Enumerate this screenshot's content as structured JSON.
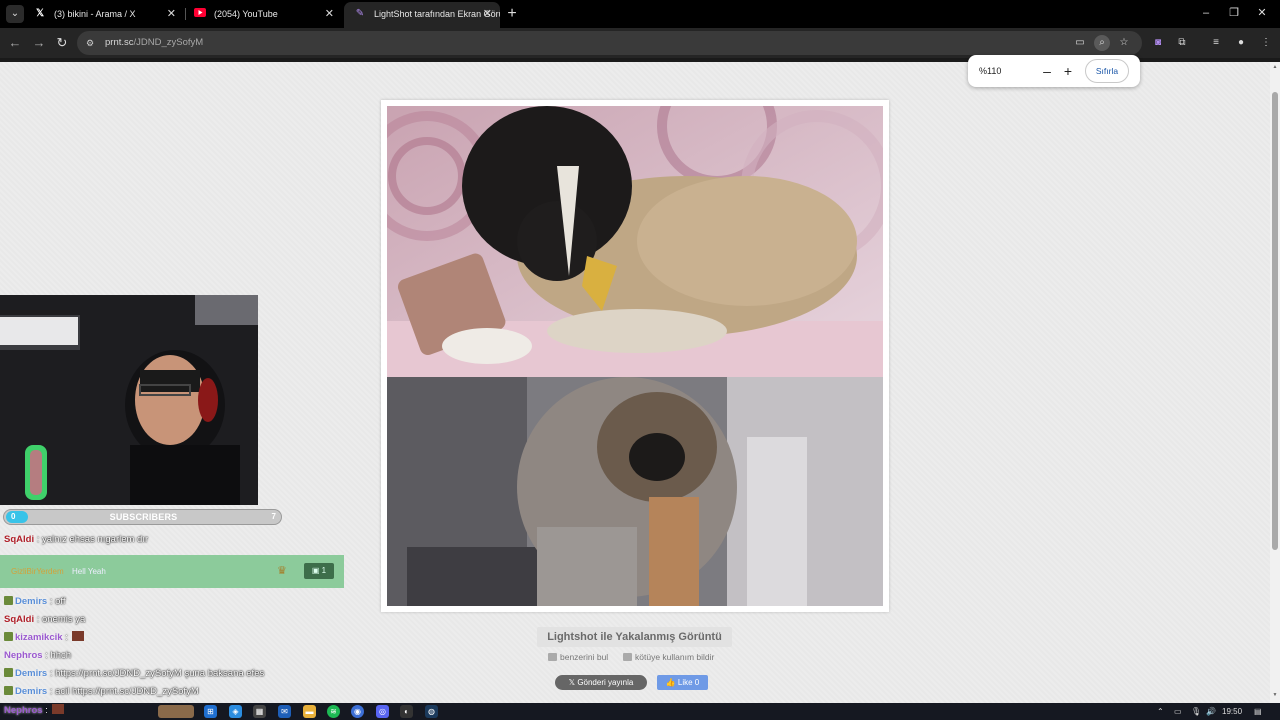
{
  "browser": {
    "tabs": [
      {
        "title": "(3) bikini - Arama / X",
        "icon": "x-logo-icon",
        "active": false
      },
      {
        "title": "(2054) YouTube",
        "icon": "youtube-icon",
        "active": false
      },
      {
        "title": "LightShot tarafından Ekran Görü",
        "icon": "lightshot-feather-icon",
        "active": true
      }
    ],
    "new_tab_label": "+",
    "window_controls": {
      "minimize": "–",
      "restore": "❐",
      "close": "✕"
    },
    "url_host": "prnt.sc",
    "url_path": "/JDND_zySofyM"
  },
  "zoom_popup": {
    "value": "%110",
    "minus": "–",
    "plus": "+",
    "reset_label": "Sıfırla"
  },
  "lightshot": {
    "caption": "Lightshot ile Yakalanmış Görüntü",
    "find_similar": "benzerini bul",
    "report_abuse": "kötüye kullanım bildir",
    "tweet_label": "Gönderi yayınla",
    "like_label": "Like 0"
  },
  "overlay": {
    "subscribers_label": "SUBSCRIBERS",
    "subscribers_left": "0",
    "subscribers_right": "7",
    "highlight": {
      "name": "GizliBirYerdem",
      "message": "Hell Yeah",
      "badge": "1"
    },
    "chat": [
      {
        "user": "SqAldi",
        "color": "#b0202a",
        "message": "yalnız ehsas nıgarlem dır",
        "badge": false
      },
      {
        "user": "Demirs",
        "color": "#5a8fd8",
        "message": "off",
        "badge": true
      },
      {
        "user": "SqAldi",
        "color": "#b0202a",
        "message": "onemis ya",
        "badge": false
      },
      {
        "user": "kizamikcik",
        "color": "#9b59d0",
        "message": "",
        "badge": true,
        "emote": true
      },
      {
        "user": "Nephros",
        "color": "#9b59d0",
        "message": "hhch",
        "badge": false
      },
      {
        "user": "Demirs",
        "color": "#5a8fd8",
        "message": "https://prnt.sc/JDND_zySofyM şuna baksana efes",
        "badge": true
      },
      {
        "user": "Demirs",
        "color": "#5a8fd8",
        "message": "acil https://prnt.sc/JDND_zySofyM",
        "badge": true
      },
      {
        "user": "Nephros",
        "color": "#9b59d0",
        "message": "",
        "badge": false,
        "emote": true
      }
    ]
  },
  "taskbar": {
    "clock": "19:50"
  },
  "colors": {
    "accent_blue": "#1a56a8",
    "like_blue": "#6f9ae6",
    "highlight_green": "#8ccb9b",
    "sub_blue": "#39c3e8"
  }
}
